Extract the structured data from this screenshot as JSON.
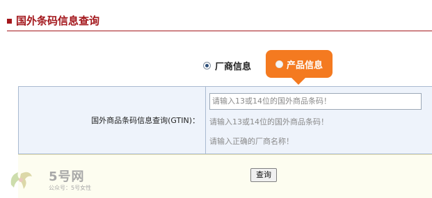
{
  "header": {
    "title": "国外条码信息查询"
  },
  "search_type": {
    "options": [
      {
        "label": "厂商信息",
        "checked": true
      },
      {
        "label": "产品信息",
        "checked": false
      }
    ]
  },
  "query_form": {
    "label": "国外商品条码信息查询(GTIN)：",
    "input_value": "请输入13或14位的国外商品条码！",
    "hints": [
      "请输入13或14位的国外商品条码！",
      "请输入正确的厂商名称！"
    ],
    "submit_label": "查询"
  },
  "watermark": {
    "brand": "5号网",
    "subtitle": "公众号：5号女性"
  },
  "colors": {
    "accent": "#a3171c",
    "bubble": "#f47a20",
    "panel_bg": "#eef3fb",
    "panel_border": "#a9bad0",
    "button_row_bg": "#fdfdf0"
  }
}
